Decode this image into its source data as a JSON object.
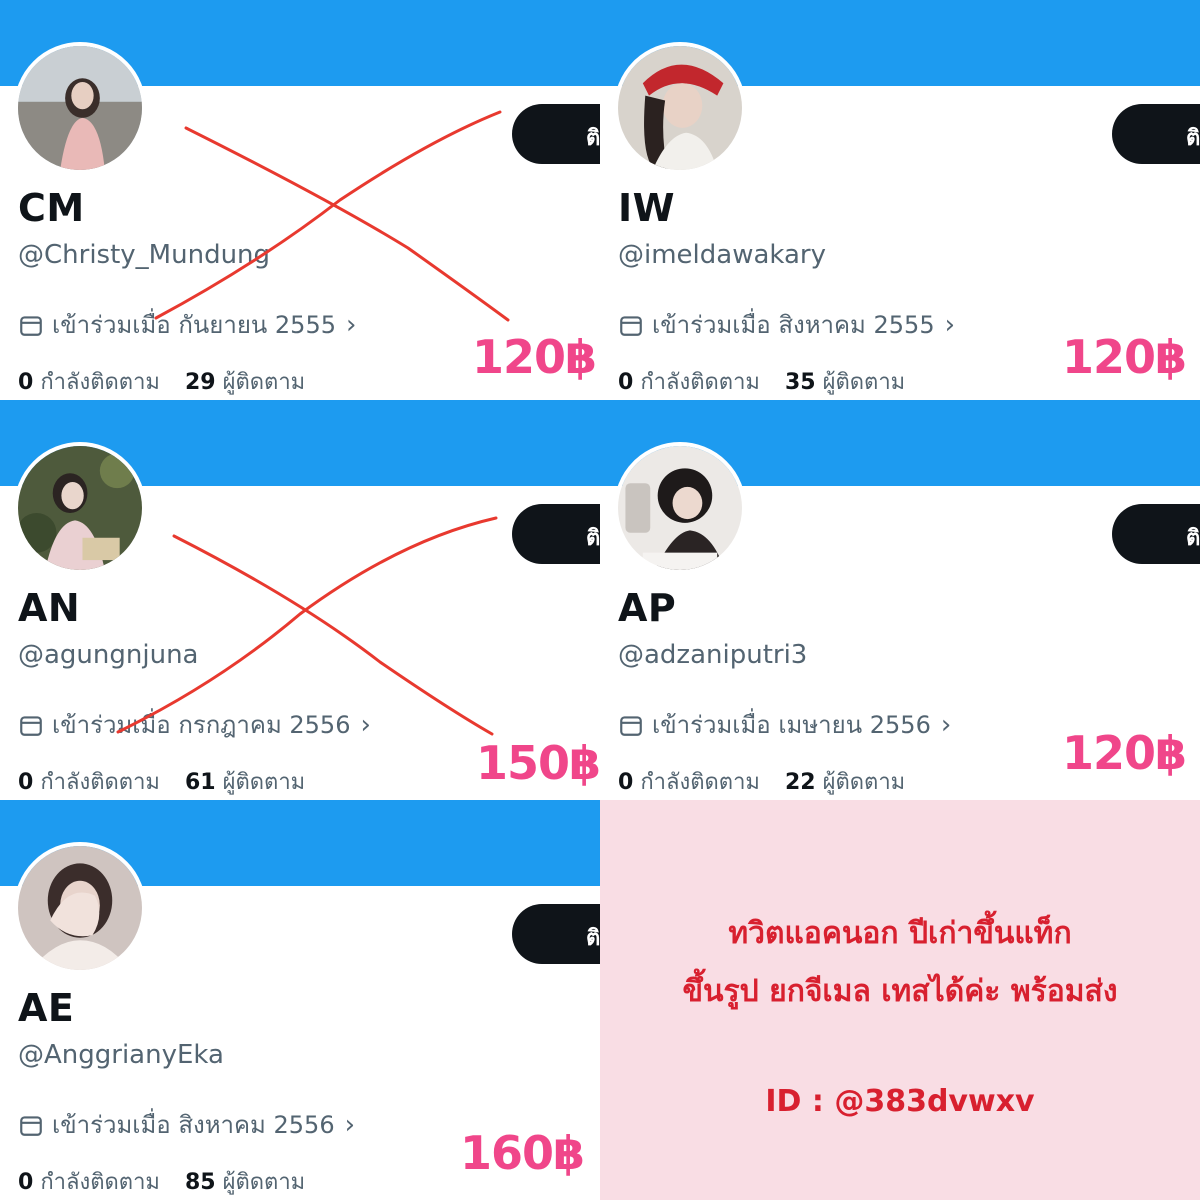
{
  "follow_button_text": "ติ",
  "accounts": [
    {
      "display_name": "CM",
      "handle": "@Christy_Mundung",
      "joined_text": "เข้าร่วมเมื่อ กันยายน 2555",
      "following_count": "0",
      "following_label": "กำลังติดตาม",
      "followers_count": "29",
      "followers_label": "ผู้ติดตาม",
      "price": "120฿",
      "crossed_out": true
    },
    {
      "display_name": "IW",
      "handle": "@imeldawakary",
      "joined_text": "เข้าร่วมเมื่อ สิงหาคม 2555",
      "following_count": "0",
      "following_label": "กำลังติดตาม",
      "followers_count": "35",
      "followers_label": "ผู้ติดตาม",
      "price": "120฿",
      "crossed_out": false
    },
    {
      "display_name": "AN",
      "handle": "@agungnjuna",
      "joined_text": "เข้าร่วมเมื่อ กรกฎาคม 2556",
      "following_count": "0",
      "following_label": "กำลังติดตาม",
      "followers_count": "61",
      "followers_label": "ผู้ติดตาม",
      "price": "150฿",
      "crossed_out": true
    },
    {
      "display_name": "AP",
      "handle": "@adzaniputri3",
      "joined_text": "เข้าร่วมเมื่อ เมษายน 2556",
      "following_count": "0",
      "following_label": "กำลังติดตาม",
      "followers_count": "22",
      "followers_label": "ผู้ติดตาม",
      "price": "120฿",
      "crossed_out": false
    },
    {
      "display_name": "AE",
      "handle": "@AnggrianyEka",
      "joined_text": "เข้าร่วมเมื่อ สิงหาคม 2556",
      "following_count": "0",
      "following_label": "กำลังติดตาม",
      "followers_count": "85",
      "followers_label": "ผู้ติดตาม",
      "price": "160฿",
      "crossed_out": false
    }
  ],
  "ad": {
    "line1": "ทวิตแอคนอก ปีเก่าขึ้นแท็ก",
    "line2": "ขึ้นรูป ยกจีเมล เทสได้ค่ะ พร้อมส่ง",
    "id_text": "ID : @383dvwxv"
  },
  "colors": {
    "banner": "#1d9bf0",
    "price": "#f0468a",
    "cross": "#e8392f",
    "ad_background": "#f9dde4",
    "ad_text": "#d8202f"
  }
}
